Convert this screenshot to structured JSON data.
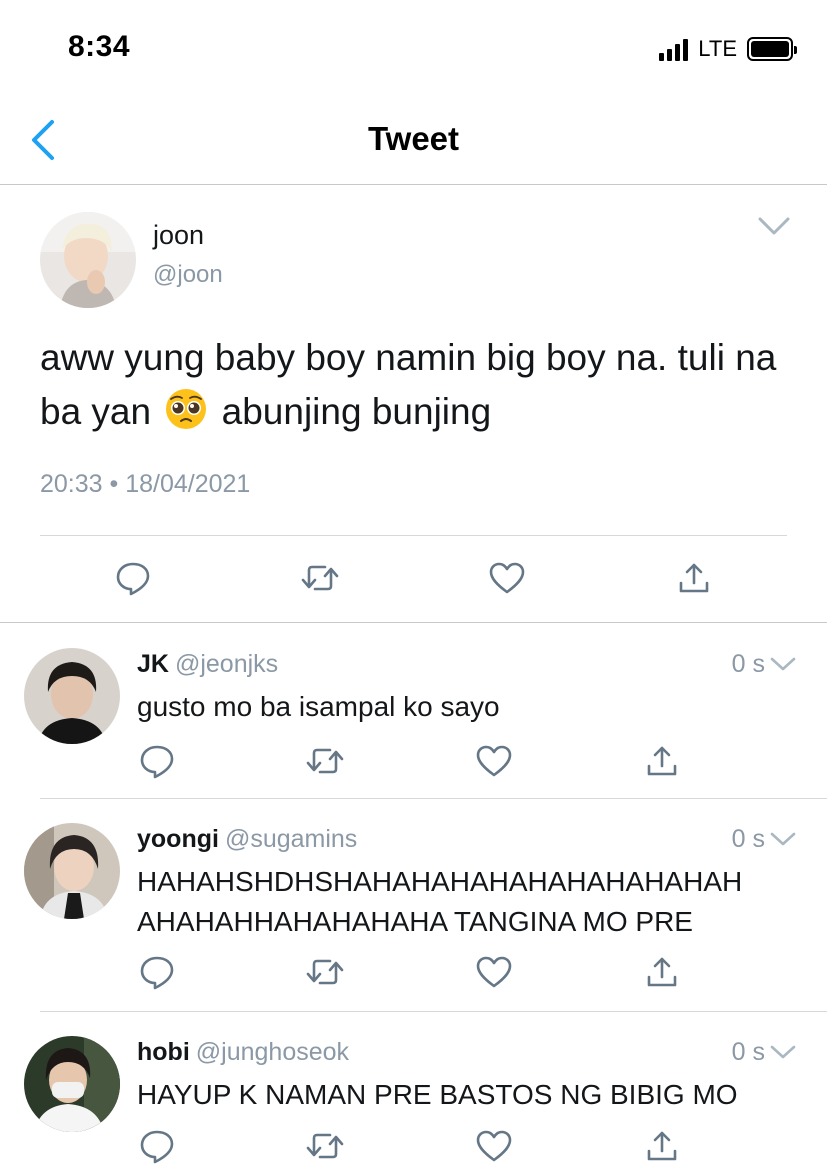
{
  "status_bar": {
    "time": "8:34",
    "network": "LTE",
    "signal_bars": 4,
    "battery_level": 1.0
  },
  "nav": {
    "title": "Tweet",
    "back_icon": "chevron-left-icon",
    "accent_color": "#1da1f2"
  },
  "main_tweet": {
    "name": "joon",
    "handle": "@joon",
    "text_before_emoji": "aww yung baby boy namin big boy na. tuli na ba yan",
    "emoji": "pleading-face-emoji",
    "text_after_emoji": "abunjing bunjing",
    "timestamp": "20:33 • 18/04/2021",
    "caret_icon": "chevron-down-icon",
    "actions": [
      "reply-icon",
      "retweet-icon",
      "like-icon",
      "share-icon"
    ]
  },
  "replies": [
    {
      "name": "JK",
      "handle": "@jeonjks",
      "time": "0 s",
      "text": "gusto mo ba isampal ko sayo"
    },
    {
      "name": "yoongi",
      "handle": "@sugamins",
      "time": "0 s",
      "text": "HAHAHSHDHSHAHAHAHAHAHAHAHAHAHAH\nAHAHAHHAHAHAHAHA TANGINA MO PRE"
    },
    {
      "name": "hobi",
      "handle": "@junghoseok",
      "time": "0 s",
      "text": "HAYUP K NAMAN PRE BASTOS NG BIBIG MO"
    }
  ],
  "colors": {
    "text": "#14171a",
    "secondary": "#8b98a5",
    "icon": "#657786",
    "divider": "#d8d8d8"
  }
}
